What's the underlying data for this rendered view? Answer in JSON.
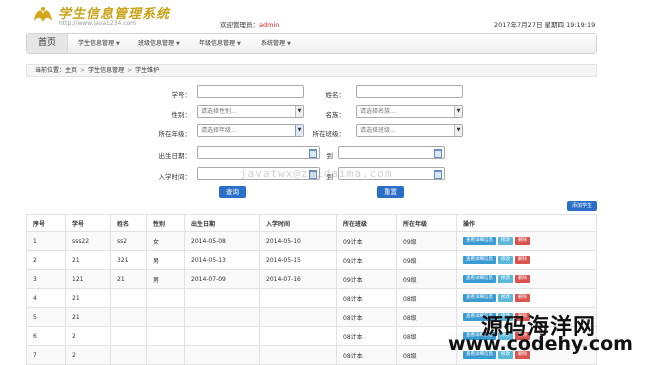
{
  "header": {
    "title": "学生信息管理系统",
    "url": "http://www.java1234.com",
    "welcome_prefix": "欢迎管理员：",
    "user": "admin",
    "datetime": "2017年7月27日 星期四 19:19:19"
  },
  "nav": {
    "home": "首页",
    "items": [
      "学生信息管理",
      "班级信息管理",
      "年级信息管理",
      "系统管理"
    ],
    "caret": "▼"
  },
  "breadcrumb": {
    "prefix": "当前位置：",
    "items": [
      "主页",
      "学生信息管理",
      "学生维护"
    ],
    "sep": ">"
  },
  "form": {
    "labels": {
      "student_no": "学号：",
      "name": "姓名：",
      "gender": "性别：",
      "ethnicity": "名族：",
      "grade": "所在年级：",
      "class": "所在班级：",
      "birth_date": "出生日期：",
      "enroll_time": "入学时间：",
      "to": "到"
    },
    "placeholders": {
      "gender": "请选择性别...",
      "ethnicity": "请选择名族...",
      "grade": "请选择年级...",
      "class": "请选择班级..."
    },
    "query_button": "查询",
    "reset_button": "重置",
    "add_button": "添加学生"
  },
  "watermark_mid": "javatwx@zhidaima.com",
  "table": {
    "headers": [
      "序号",
      "学号",
      "姓名",
      "性别",
      "出生日期",
      "入学时间",
      "所在班级",
      "所在年级",
      "操作"
    ],
    "rows": [
      [
        "1",
        "sss22",
        "ss2",
        "女",
        "2014-05-08",
        "2014-05-10",
        "09计本",
        "09级"
      ],
      [
        "2",
        "21",
        "321",
        "男",
        "2014-05-13",
        "2014-05-15",
        "09计本",
        "09级"
      ],
      [
        "3",
        "121",
        "21",
        "男",
        "2014-07-09",
        "2014-07-16",
        "09计本",
        "09级"
      ],
      [
        "4",
        "21",
        "",
        "",
        "",
        "",
        "08计本",
        "08级"
      ],
      [
        "5",
        "21",
        "",
        "",
        "",
        "",
        "08计本",
        "08级"
      ],
      [
        "6",
        "2",
        "",
        "",
        "",
        "",
        "08计本",
        "08级"
      ],
      [
        "7",
        "2",
        "",
        "",
        "",
        "",
        "08计本",
        "08级"
      ]
    ],
    "actions": {
      "view": "查看详细信息",
      "edit": "修改",
      "delete": "删除"
    }
  },
  "watermark": {
    "title": "源码海洋网",
    "url": "www.codehy.com"
  }
}
